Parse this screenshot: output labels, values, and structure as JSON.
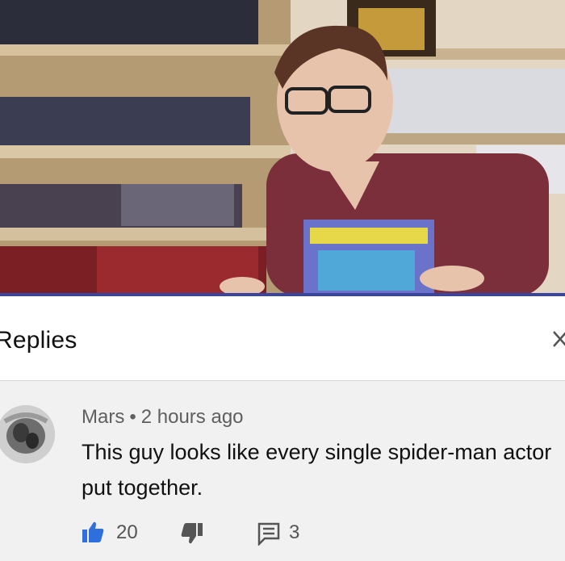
{
  "video": {
    "description_icon": "video-frame"
  },
  "replies": {
    "title": "Replies",
    "close_icon": "close-icon"
  },
  "comment": {
    "author": "Mars",
    "separator": "•",
    "time": "2 hours ago",
    "text": "This guy looks like every single spider-man actor put together.",
    "likes": "20",
    "replies": "3",
    "like_icon": "thumbs-up-icon",
    "dislike_icon": "thumbs-down-icon",
    "reply_icon": "reply-icon"
  },
  "colors": {
    "accent": "#2f6fdd",
    "header_bg": "#ffffff",
    "comment_bg": "#f1f1f1"
  }
}
